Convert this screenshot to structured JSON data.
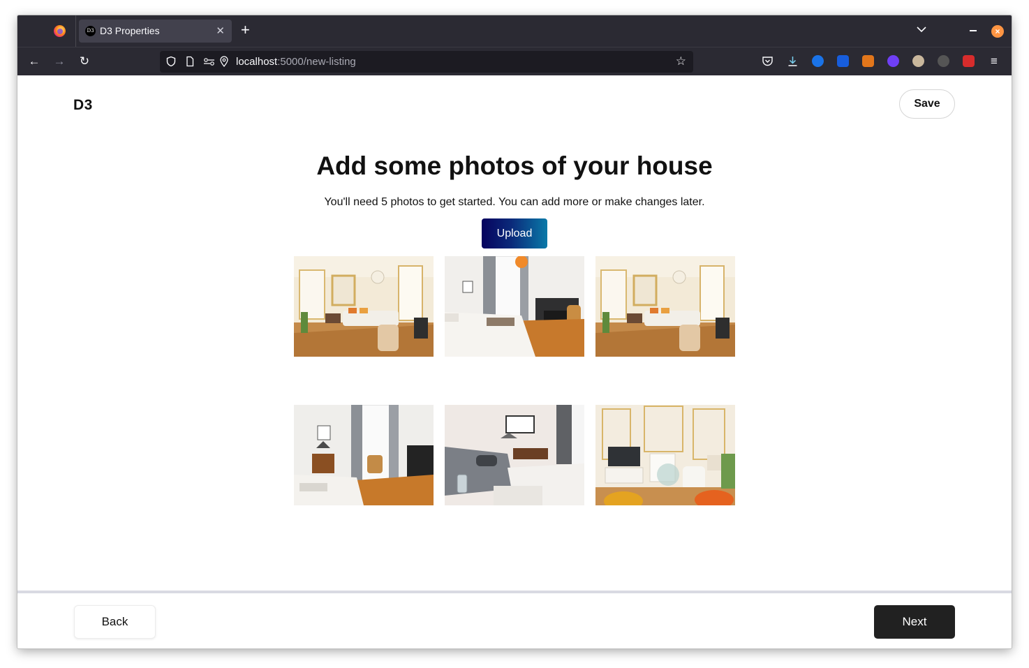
{
  "browser": {
    "tab_title": "D3 Properties",
    "tab_favicon_text": "D3",
    "url_host": "localhost",
    "url_path": ":5000/new-listing"
  },
  "header": {
    "logo": "D3",
    "save_label": "Save"
  },
  "main": {
    "title": "Add some photos of your house",
    "subtitle": "You'll need 5 photos to get started. You can add more or make changes later.",
    "upload_label": "Upload"
  },
  "photos": [
    {
      "scene": "living-room"
    },
    {
      "scene": "bedroom-fireplace"
    },
    {
      "scene": "living-room"
    },
    {
      "scene": "bedroom-desk"
    },
    {
      "scene": "bedroom-sofa"
    },
    {
      "scene": "lounge-tv"
    }
  ],
  "footer": {
    "back_label": "Back",
    "next_label": "Next"
  },
  "colors": {
    "browser_chrome": "#2b2a33",
    "upload_gradient_start": "#06035e",
    "upload_gradient_end": "#0a79a8",
    "next_button": "#212121"
  }
}
